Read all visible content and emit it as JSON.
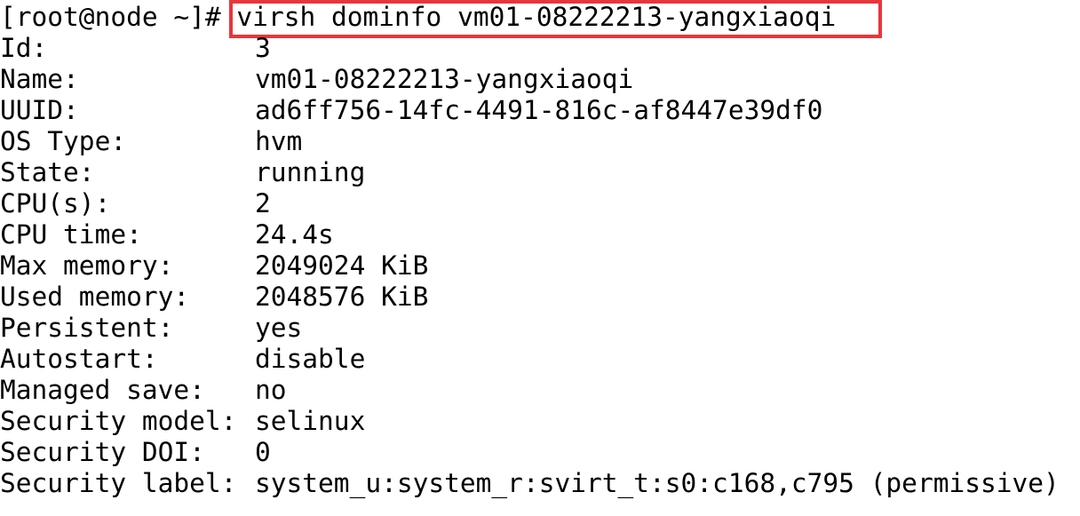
{
  "prompt": "[root@node ~]# ",
  "command": "virsh dominfo vm01-08222213-yangxiaoqi",
  "highlight_color": "#e8363b",
  "rows": [
    {
      "key": "Id:",
      "value": "3"
    },
    {
      "key": "Name:",
      "value": "vm01-08222213-yangxiaoqi"
    },
    {
      "key": "UUID:",
      "value": "ad6ff756-14fc-4491-816c-af8447e39df0"
    },
    {
      "key": "OS Type:",
      "value": "hvm"
    },
    {
      "key": "State:",
      "value": "running"
    },
    {
      "key": "CPU(s):",
      "value": "2"
    },
    {
      "key": "CPU time:",
      "value": "24.4s"
    },
    {
      "key": "Max memory:",
      "value": "2049024 KiB"
    },
    {
      "key": "Used memory:",
      "value": "2048576 KiB"
    },
    {
      "key": "Persistent:",
      "value": "yes"
    },
    {
      "key": "Autostart:",
      "value": "disable"
    },
    {
      "key": "Managed save:",
      "value": "no"
    },
    {
      "key": "Security model:",
      "value": "selinux"
    },
    {
      "key": "Security DOI:",
      "value": "0"
    },
    {
      "key": "Security label:",
      "value": "system_u:system_r:svirt_t:s0:c168,c795 (permissive)"
    }
  ]
}
